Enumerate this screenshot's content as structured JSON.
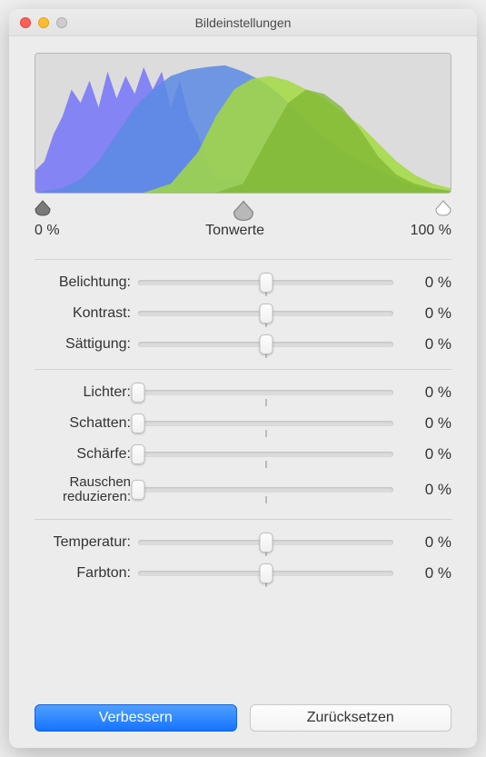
{
  "window": {
    "title": "Bildeinstellungen"
  },
  "levels": {
    "label": "Tonwerte",
    "left": "0 %",
    "right": "100 %",
    "black": 0,
    "mid": 50,
    "white": 100
  },
  "sliders": {
    "group1": [
      {
        "key": "belichtung",
        "label": "Belichtung:",
        "value": "0 %",
        "pos": 50,
        "tick": true
      },
      {
        "key": "kontrast",
        "label": "Kontrast:",
        "value": "0 %",
        "pos": 50,
        "tick": true
      },
      {
        "key": "saettigung",
        "label": "Sättigung:",
        "value": "0 %",
        "pos": 50,
        "tick": true
      }
    ],
    "group2": [
      {
        "key": "lichter",
        "label": "Lichter:",
        "value": "0 %",
        "pos": 0,
        "tick": true
      },
      {
        "key": "schatten",
        "label": "Schatten:",
        "value": "0 %",
        "pos": 0,
        "tick": true
      },
      {
        "key": "schaerfe",
        "label": "Schärfe:",
        "value": "0 %",
        "pos": 0,
        "tick": true
      },
      {
        "key": "rauschen",
        "label": "Rauschen\nreduzieren:",
        "value": "0 %",
        "pos": 0,
        "tick": true,
        "multiline": true
      }
    ],
    "group3": [
      {
        "key": "temperatur",
        "label": "Temperatur:",
        "value": "0 %",
        "pos": 50,
        "tick": true
      },
      {
        "key": "farbton",
        "label": "Farbton:",
        "value": "0 %",
        "pos": 50,
        "tick": true
      }
    ]
  },
  "buttons": {
    "enhance": "Verbessern",
    "reset": "Zurücksetzen"
  }
}
